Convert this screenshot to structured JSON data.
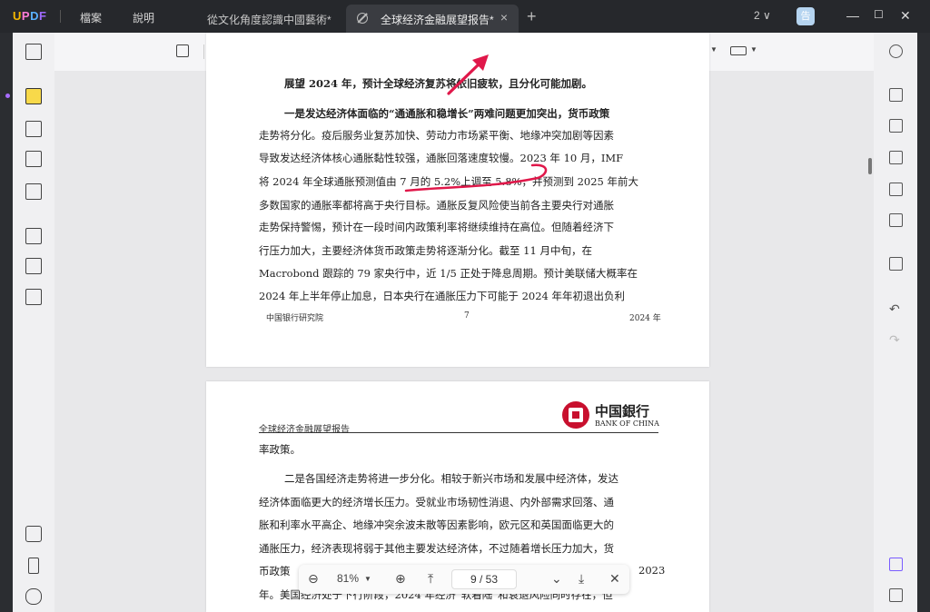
{
  "app": {
    "logo": "UPDF"
  },
  "menu": {
    "file": "檔案",
    "help": "說明"
  },
  "tabs": [
    {
      "label": "從文化角度認識中國藝術*"
    },
    {
      "label": "全球经济金融展望报告*"
    }
  ],
  "window": {
    "page_indicator": "2 ∨",
    "avatar_text": "告"
  },
  "page1": {
    "lines": [
      "展望 2024 年，预计全球经济复苏将依旧疲软，且分化可能加剧。",
      "一是发达经济体面临的“通通胀和稳增长”两难问题更加突出，货币政策",
      "走势将分化。疫后服务业复苏加快、劳动力市场紧平衡、地缘冲突加剧等因素",
      "导致发达经济体核心通胀黏性较强，通胀回落速度较慢。2023 年 10 月，IMF",
      "将 2024 年全球通胀预测值由 7 月的 5.2%上调至 5.8%，并预测到 2025 年前大",
      "多数国家的通胀率都将高于央行目标。通胀反复风险使当前各主要央行对通胀",
      "走势保持警惕，预计在一段时间内政策利率将继续维持在高位。但随着经济下",
      "行压力加大，主要经济体货币政策走势将逐渐分化。截至 11 月中旬，在",
      "Macrobond 跟踪的 79 家央行中，近 1/5 正处于降息周期。预计美联储大概率在",
      "2024 年上半年停止加息，日本央行在通胀压力下可能于 2024 年年初退出负利"
    ],
    "footer_left": "中国银行研究院",
    "footer_center": "7",
    "footer_right": "2024 年"
  },
  "page2": {
    "header_title": "全球经济金融展望报告",
    "bank_cn": "中国銀行",
    "bank_en": "BANK OF CHINA",
    "lines": [
      "率政策。",
      "二是各国经济走势将进一步分化。相较于新兴市场和发展中经济体，发达",
      "经济体面临更大的经济增长压力。受就业市场韧性消退、内外部需求回落、通",
      "胀和利率水平高企、地缘冲突余波未散等因素影响，欧元区和英国面临更大的",
      "通胀压力，经济表现将弱于其他主要发达经济体，不过随着增长压力加大，货",
      "币政策",
      "2023",
      "年。美国经济处于下行阶段，2024 年经济“软着陆”和衰退风险同时存在，但"
    ]
  },
  "navbar": {
    "zoom": "81%",
    "current_page": "9",
    "total_pages": "53",
    "page_display": "9  /  53"
  },
  "colors": {
    "highlight_active": "#f8d94a",
    "annotation_red": "#e0184a"
  }
}
